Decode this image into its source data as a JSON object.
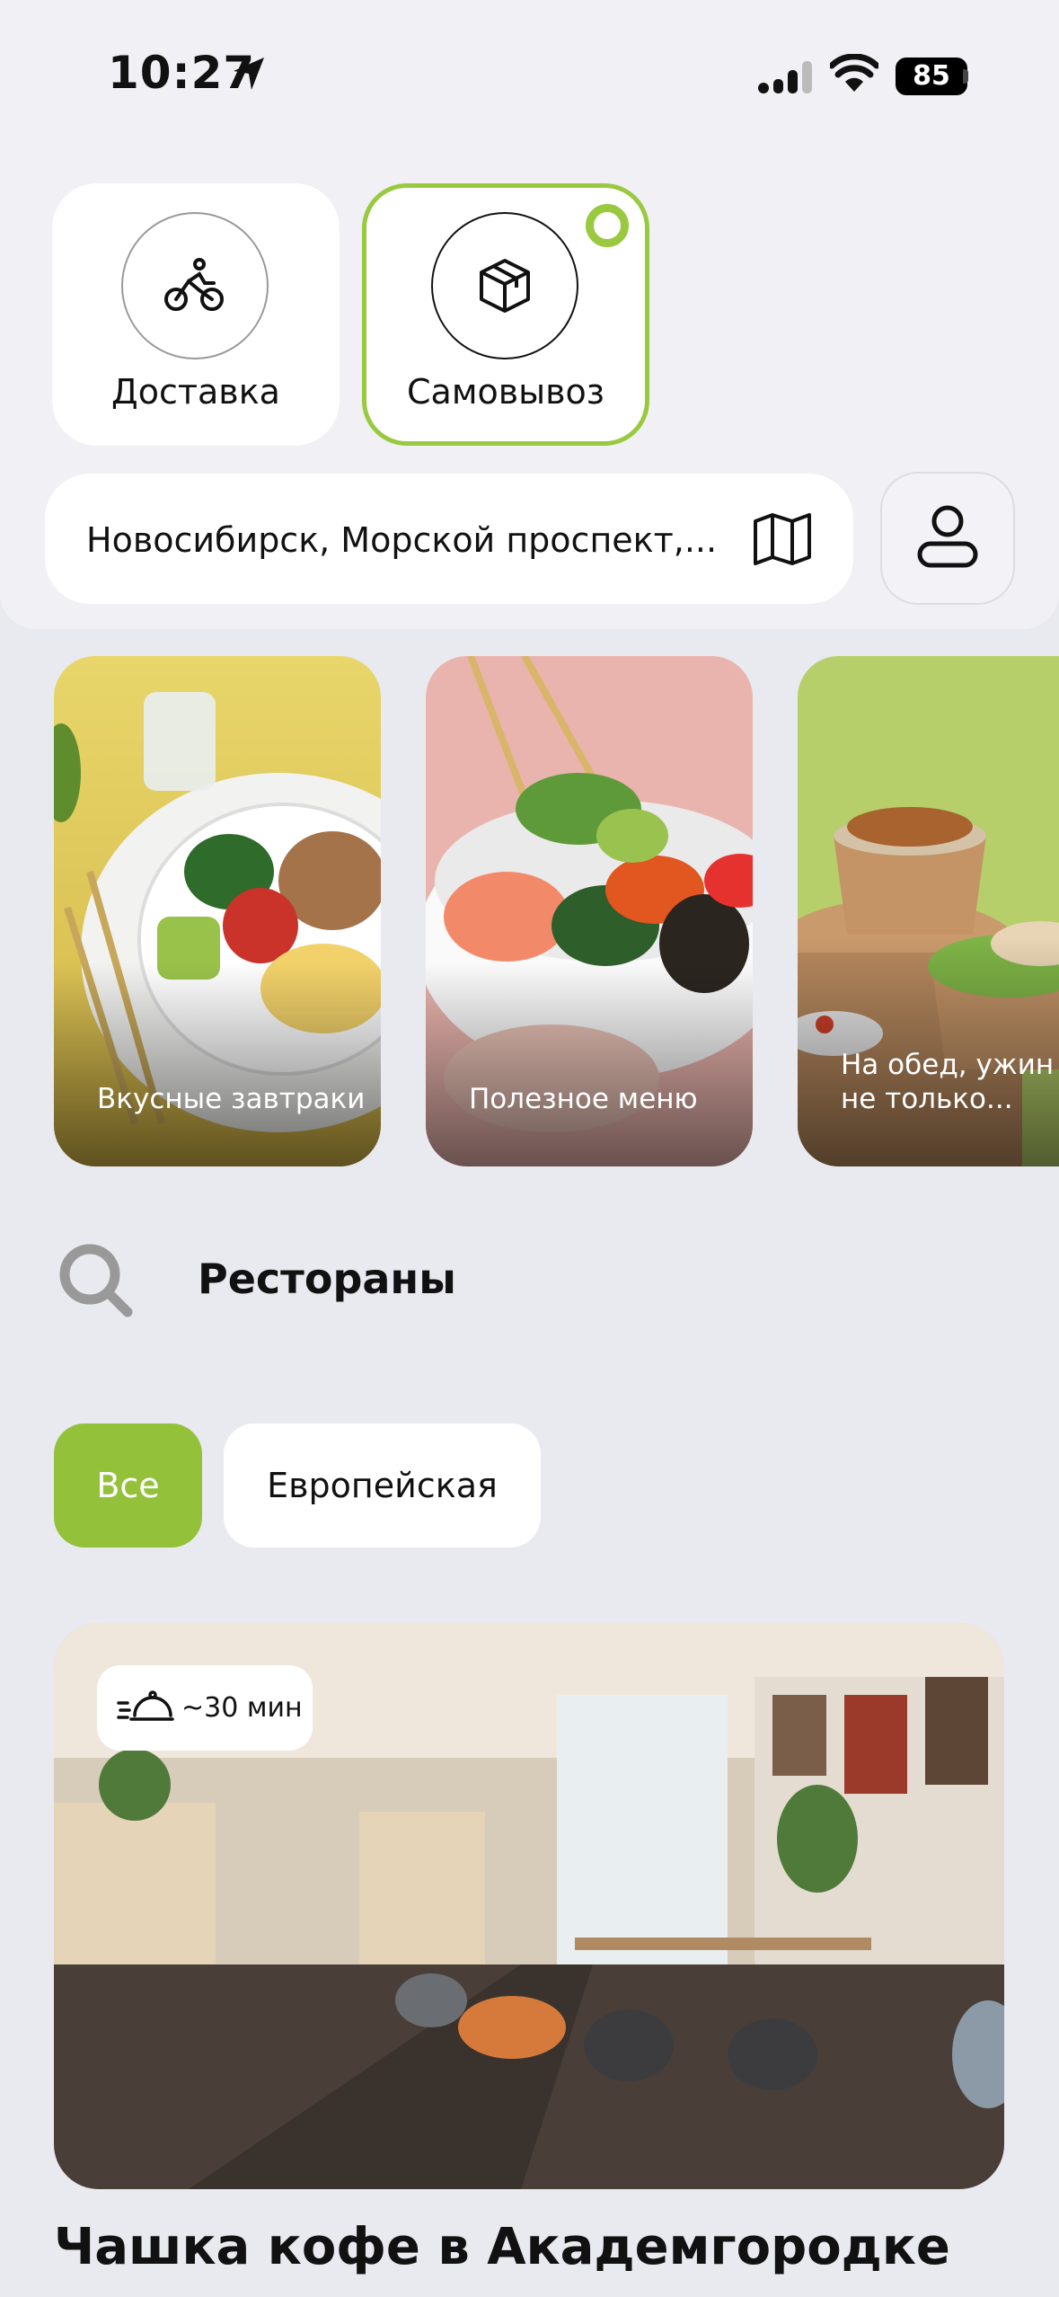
{
  "status_bar": {
    "time": "10:27",
    "battery": "85"
  },
  "modes": [
    {
      "label": "Доставка",
      "icon": "bicycle-courier-icon",
      "selected": false
    },
    {
      "label": "Самовывоз",
      "icon": "package-box-icon",
      "selected": true
    }
  ],
  "address": {
    "text": "Новосибирск, Морской проспект,...",
    "icon": "map-icon"
  },
  "stories": [
    {
      "label": "Вкусные завтраки"
    },
    {
      "label": "Полезное меню"
    },
    {
      "label_lines": [
        "На обед, ужин и",
        "не только..."
      ]
    }
  ],
  "restaurants": {
    "title": "Рестораны",
    "filters": [
      {
        "label": "Все",
        "selected": true
      },
      {
        "label": "Европейская",
        "selected": false
      }
    ],
    "cards": [
      {
        "name": "Чашка кофе в Академгородке",
        "delivery_time": "~30 мин"
      }
    ]
  },
  "colors": {
    "accent": "#93c23a",
    "active_border": "#99c93f",
    "background": "#e9e9f0"
  }
}
